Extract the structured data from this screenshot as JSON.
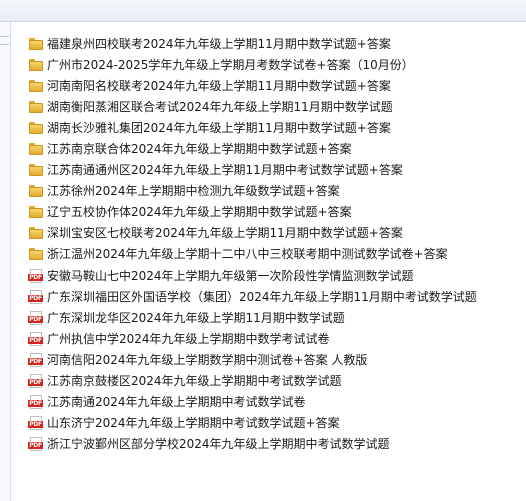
{
  "items": [
    {
      "type": "folder",
      "label": "福建泉州四校联考2024年九年级上学期11月期中数学试题+答案"
    },
    {
      "type": "folder",
      "label": "广州市2024-2025学年九年级上学期月考数学试卷+答案（10月份）"
    },
    {
      "type": "folder",
      "label": "河南南阳名校联考2024年九年级上学期11月期中数学试题+答案"
    },
    {
      "type": "folder",
      "label": "湖南衡阳蒸湘区联合考试2024年九年级上学期11月期中数学试题"
    },
    {
      "type": "folder",
      "label": "湖南长沙雅礼集团2024年九年级上学期11月期中数学试题+答案"
    },
    {
      "type": "folder",
      "label": "江苏南京联合体2024年九年级上学期期中数学试题+答案"
    },
    {
      "type": "folder",
      "label": "江苏南通通州区2024年九年级上学期11月期中考试数学试题+答案"
    },
    {
      "type": "folder",
      "label": "江苏徐州2024年上学期期中检测九年级数学试题+答案"
    },
    {
      "type": "folder",
      "label": "辽宁五校协作体2024年九年级上学期期中数学试题+答案"
    },
    {
      "type": "folder",
      "label": "深圳宝安区七校联考2024年九年级上学期11月期中数学试题+答案"
    },
    {
      "type": "folder",
      "label": "浙江温州2024年九年级上学期十二中八中三校联考期中测试数学试卷+答案"
    },
    {
      "type": "pdf",
      "label": "安徽马鞍山七中2024年上学期九年级第一次阶段性学情监测数学试题"
    },
    {
      "type": "pdf",
      "label": "广东深圳福田区外国语学校（集团）2024年九年级上学期11月期中考试数学试题"
    },
    {
      "type": "pdf",
      "label": "广东深圳龙华区2024年九年级上学期11月期中数学试题"
    },
    {
      "type": "pdf",
      "label": "广州执信中学2024年九年级上学期期中数学考试试卷"
    },
    {
      "type": "pdf",
      "label": "河南信阳2024年九年级上学期数学期中测试卷+答案 人教版"
    },
    {
      "type": "pdf",
      "label": "江苏南京鼓楼区2024年九年级上学期期中考试数学试题"
    },
    {
      "type": "pdf",
      "label": "江苏南通2024年九年级上学期期中考试数学试卷"
    },
    {
      "type": "pdf",
      "label": "山东济宁2024年九年级上学期期中考试数学试题+答案"
    },
    {
      "type": "pdf",
      "label": "浙江宁波鄞州区部分学校2024年九年级上学期期中考试数学试题"
    }
  ],
  "icons": {
    "folder": "folder-icon",
    "pdf": "pdf-icon",
    "pdf_badge": "PDF"
  },
  "colors": {
    "folder": "#e8b235",
    "pdf_badge": "#d2241c"
  }
}
